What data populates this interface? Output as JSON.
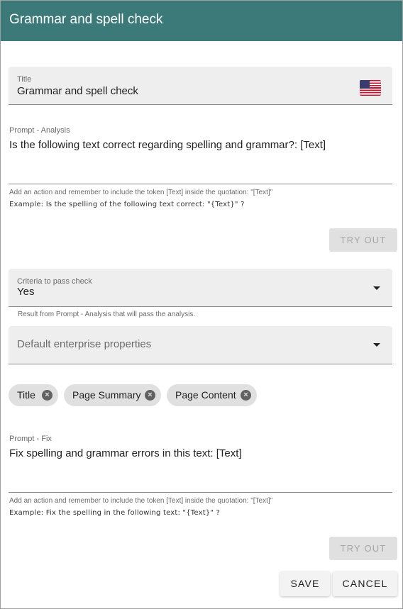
{
  "dialog": {
    "title": "Grammar and spell check"
  },
  "title_field": {
    "label": "Title",
    "value": "Grammar and spell check"
  },
  "prompt_analysis": {
    "label": "Prompt - Analysis",
    "value": "Is the following text correct regarding spelling and grammar?: [Text]",
    "helper": "Add an action and remember to include the token [Text] inside the quotation: \"[Text]\"",
    "example": "Example: Is the spelling of the following text correct: \"{Text}\" ?",
    "try_out_label": "TRY OUT"
  },
  "criteria": {
    "label": "Criteria to pass check",
    "value": "Yes",
    "helper": "Result from Prompt - Analysis that will pass the analysis."
  },
  "enterprise": {
    "placeholder": "Default enterprise properties"
  },
  "chips": [
    "Title",
    "Page Summary",
    "Page Content"
  ],
  "prompt_fix": {
    "label": "Prompt - Fix",
    "value": "Fix spelling and grammar errors in this text: [Text]",
    "helper": "Add an action and remember to include the token [Text] inside the quotation: \"[Text]\"",
    "example": "Example: Fix the spelling in the following text: \"{Text}\" ?",
    "try_out_label": "TRY OUT"
  },
  "actions": {
    "save_label": "SAVE",
    "cancel_label": "CANCEL"
  },
  "colors": {
    "header": "#3c7a7a"
  }
}
